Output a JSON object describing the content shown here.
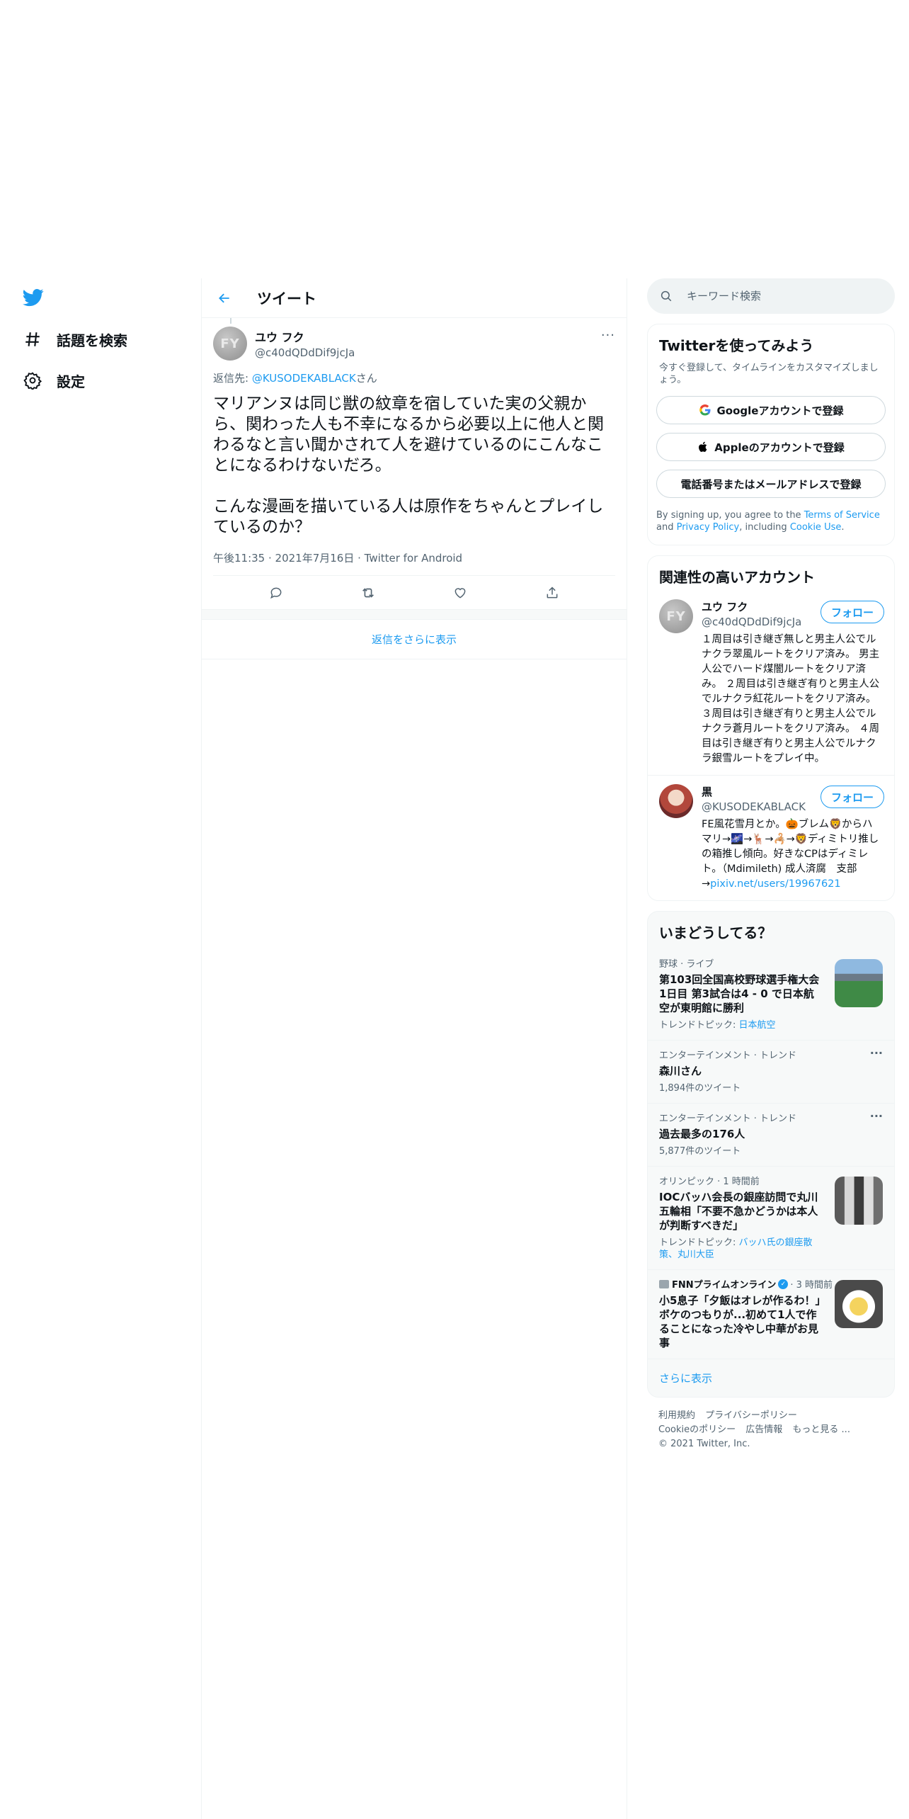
{
  "nav": {
    "explore_label": "話題を検索",
    "settings_label": "設定"
  },
  "header": {
    "title": "ツイート"
  },
  "tweet": {
    "avatar_text": "FY",
    "author_name": "ユウ フク",
    "author_handle": "@c40dQDdDif9jcJa",
    "reply_prefix": "返信先: ",
    "reply_mention": "@KUSODEKABLACK",
    "reply_suffix": "さん",
    "text": "マリアンヌは同じ獣の紋章を宿していた実の父親から、関わった人も不幸になるから必要以上に他人と関わるなと言い聞かされて人を避けているのにこんなことになるわけないだろ。\n\nこんな漫画を描いている人は原作をちゃんとプレイしているのか？",
    "meta": "午後11:35 · 2021年7月16日 · Twitter for Android",
    "more": "···"
  },
  "show_more_replies": "返信をさらに表示",
  "search": {
    "placeholder": "キーワード検索"
  },
  "signup": {
    "title": "Twitterを使ってみよう",
    "subtitle": "今すぐ登録して、タイムラインをカスタマイズしましょう。",
    "google": "Googleアカウントで登録",
    "apple": "Appleのアカウントで登録",
    "phone": "電話番号またはメールアドレスで登録",
    "terms_1": "By signing up, you agree to the ",
    "terms_link1": "Terms of Service",
    "terms_2": " and ",
    "terms_link2": "Privacy Policy",
    "terms_3": ", including ",
    "terms_link3": "Cookie Use",
    "terms_4": "."
  },
  "relevant": {
    "title": "関連性の高いアカウント",
    "follow_label": "フォロー",
    "accounts": [
      {
        "avatar_text": "FY",
        "name": "ユウ フク",
        "handle": "@c40dQDdDif9jcJa",
        "bio": "１周目は引き継ぎ無しと男主人公でルナクラ翠風ルートをクリア済み。 男主人公でハード煤闇ルートをクリア済み。 ２周目は引き継ぎ有りと男主人公でルナクラ紅花ルートをクリア済み。 ３周目は引き継ぎ有りと男主人公でルナクラ蒼月ルートをクリア済み。 ４周目は引き継ぎ有りと男主人公でルナクラ銀雪ルートをプレイ中。"
      },
      {
        "name": "黒",
        "handle": "@KUSODEKABLACK",
        "bio": "FE風花雪月とか。🎃ブレム🦁からハマリ→🌌→🦌→🦂→🦁ディミトリ推しの箱推し傾向。好きなCPはディミレト。（Mdimileth) 成人済腐　支部→",
        "bio_link": "pixiv.net/users/19967621"
      }
    ]
  },
  "trends": {
    "title": "いまどうしてる？",
    "items": [
      {
        "context": "野球 · ライブ",
        "title": "第103回全国高校野球選手権大会1日目 第3試合は4 - 0 で日本航空が東明館に勝利",
        "sub_prefix": "トレンドトピック: ",
        "sub_link": "日本航空"
      },
      {
        "context": "エンターテインメント · トレンド",
        "title": "森川さん",
        "sub": "1,894件のツイート"
      },
      {
        "context": "エンターテインメント · トレンド",
        "title": "過去最多の176人",
        "sub": "5,877件のツイート"
      },
      {
        "context": "オリンピック · 1 時間前",
        "title": "IOCバッハ会長の銀座訪問で丸川五輪相「不要不急かどうかは本人が判断すべきだ」",
        "sub_prefix": "トレンドトピック: ",
        "sub_link": "バッハ氏の銀座散策、丸川大臣"
      },
      {
        "source": "FNNプライムオンライン",
        "time": " · 3 時間前",
        "title": "小5息子「夕飯はオレが作るわ！」ボケのつもりが...初めて1人で作ることになった冷やし中華がお見事"
      }
    ],
    "more_label": "さらに表示"
  },
  "footer": {
    "row1": [
      "利用規約",
      "プライバシーポリシー"
    ],
    "row2": [
      "Cookieのポリシー",
      "広告情報",
      "もっと見る ..."
    ],
    "copyright": "© 2021 Twitter, Inc."
  },
  "colors": {
    "accent": "#1d9bf0",
    "text": "#0f1419",
    "secondary": "#536471",
    "border": "#eff3f4"
  }
}
